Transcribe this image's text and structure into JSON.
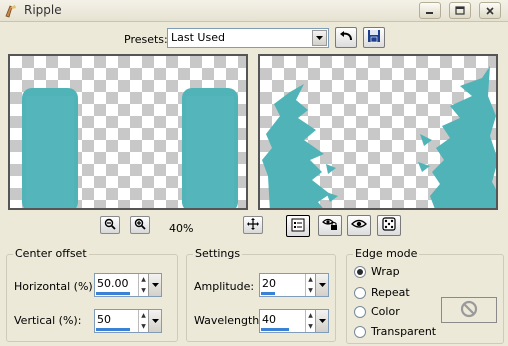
{
  "window": {
    "title": "Ripple",
    "buttons": [
      "minimize-icon",
      "maximize-icon",
      "close-icon"
    ]
  },
  "presets": {
    "label": "Presets:",
    "value": "Last Used"
  },
  "zoom": {
    "level": "40%"
  },
  "center_offset": {
    "title": "Center offset",
    "horizontal_label": "Horizontal (%):",
    "horizontal_value": "50.00",
    "vertical_label": "Vertical (%):",
    "vertical_value": "50"
  },
  "settings": {
    "title": "Settings",
    "amplitude_label": "Amplitude:",
    "amplitude_value": "20",
    "wavelength_label": "Wavelength:",
    "wavelength_value": "40"
  },
  "edge_mode": {
    "title": "Edge mode",
    "options": [
      "Wrap",
      "Repeat",
      "Color",
      "Transparent"
    ],
    "selected": "Wrap"
  },
  "colors": {
    "teal": "#4fb3b8",
    "teal_dark": "#3a9ea4",
    "progress": "#3b82d6"
  }
}
